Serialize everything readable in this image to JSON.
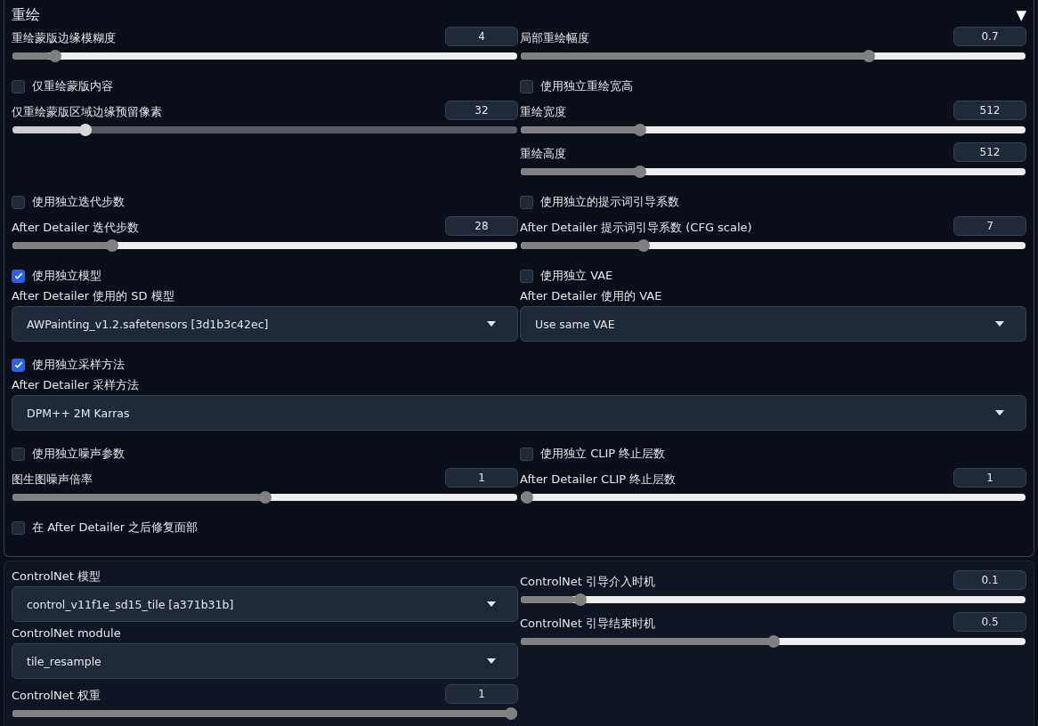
{
  "panel": {
    "title": "重绘",
    "toggle": "▼",
    "expanded": true,
    "rows": [
      {
        "columns": [
          [
            {
              "kind": "slider",
              "label": "重绘蒙版边缘模糊度",
              "value": "4",
              "level": 0.075,
              "disabled": false
            }
          ],
          [
            {
              "kind": "slider",
              "label": "局部重绘幅度",
              "value": "0.7",
              "level": 0.695,
              "disabled": false
            }
          ]
        ]
      },
      {
        "columns": [
          [
            {
              "kind": "checkbox",
              "label": "仅重绘蒙版内容",
              "checked": false
            },
            {
              "kind": "slider",
              "label": "仅重绘蒙版区域边缘预留像素",
              "value": "32",
              "level": 0.136,
              "disabled": true
            }
          ],
          [
            {
              "kind": "checkbox",
              "label": "使用独立重绘宽高",
              "checked": false
            },
            {
              "kind": "slider",
              "label": "重绘宽度",
              "value": "512",
              "level": 0.23,
              "disabled": false
            },
            {
              "kind": "slider",
              "label": "重绘高度",
              "value": "512",
              "level": 0.23,
              "disabled": false
            }
          ]
        ]
      },
      {
        "columns": [
          [
            {
              "kind": "checkbox",
              "label": "使用独立迭代步数",
              "checked": false
            },
            {
              "kind": "slider",
              "label": "After Detailer 迭代步数",
              "value": "28",
              "level": 0.19,
              "disabled": false
            }
          ],
          [
            {
              "kind": "checkbox",
              "label": "使用独立的提示词引导系数",
              "checked": false
            },
            {
              "kind": "slider",
              "label": "After Detailer 提示词引导系数 (CFG scale)",
              "value": "7",
              "level": 0.237,
              "disabled": false
            }
          ]
        ]
      },
      {
        "columns": [
          [
            {
              "kind": "checkbox",
              "label": "使用独立模型",
              "checked": true
            },
            {
              "kind": "dropdown",
              "label": "After Detailer 使用的 SD 模型",
              "value": "AWPainting_v1.2.safetensors [3d1b3c42ec]"
            }
          ],
          [
            {
              "kind": "checkbox",
              "label": "使用独立 VAE",
              "checked": false
            },
            {
              "kind": "dropdown",
              "label": "After Detailer 使用的 VAE",
              "value": "Use same VAE"
            }
          ]
        ]
      },
      {
        "columns": [
          [
            {
              "kind": "checkbox",
              "label": "使用独立采样方法",
              "checked": true
            },
            {
              "kind": "dropdown",
              "label": "After Detailer 采样方法",
              "value": "DPM++ 2M Karras"
            }
          ]
        ]
      },
      {
        "columns": [
          [
            {
              "kind": "checkbox",
              "label": "使用独立噪声参数",
              "checked": false
            },
            {
              "kind": "slider",
              "label": "图生图噪声倍率",
              "value": "1",
              "level": 0.5,
              "disabled": false
            }
          ],
          [
            {
              "kind": "checkbox",
              "label": "使用独立 CLIP 终止层数",
              "checked": false
            },
            {
              "kind": "slider",
              "label": "After Detailer CLIP 终止层数",
              "value": "1",
              "level": 0,
              "disabled": false
            }
          ]
        ]
      },
      {
        "columns": [
          [
            {
              "kind": "checkbox",
              "label": "在 After Detailer 之后修复面部",
              "checked": false
            }
          ]
        ]
      }
    ]
  },
  "controlnet": {
    "columns": [
      [
        {
          "kind": "dropdown",
          "label": "ControlNet 模型",
          "value": "control_v11f1e_sd15_tile [a371b31b]"
        },
        {
          "kind": "dropdown",
          "label": "ControlNet module",
          "value": "tile_resample"
        },
        {
          "kind": "slider",
          "label": "ControlNet 权重",
          "value": "1",
          "level": 1,
          "disabled": false
        }
      ],
      [
        {
          "kind": "slider",
          "label": "ControlNet 引导介入时机",
          "value": "0.1",
          "level": 0.108,
          "disabled": false
        },
        {
          "kind": "slider",
          "label": "ControlNet 引导结束时机",
          "value": "0.5",
          "level": 0.5,
          "disabled": false
        }
      ]
    ]
  }
}
